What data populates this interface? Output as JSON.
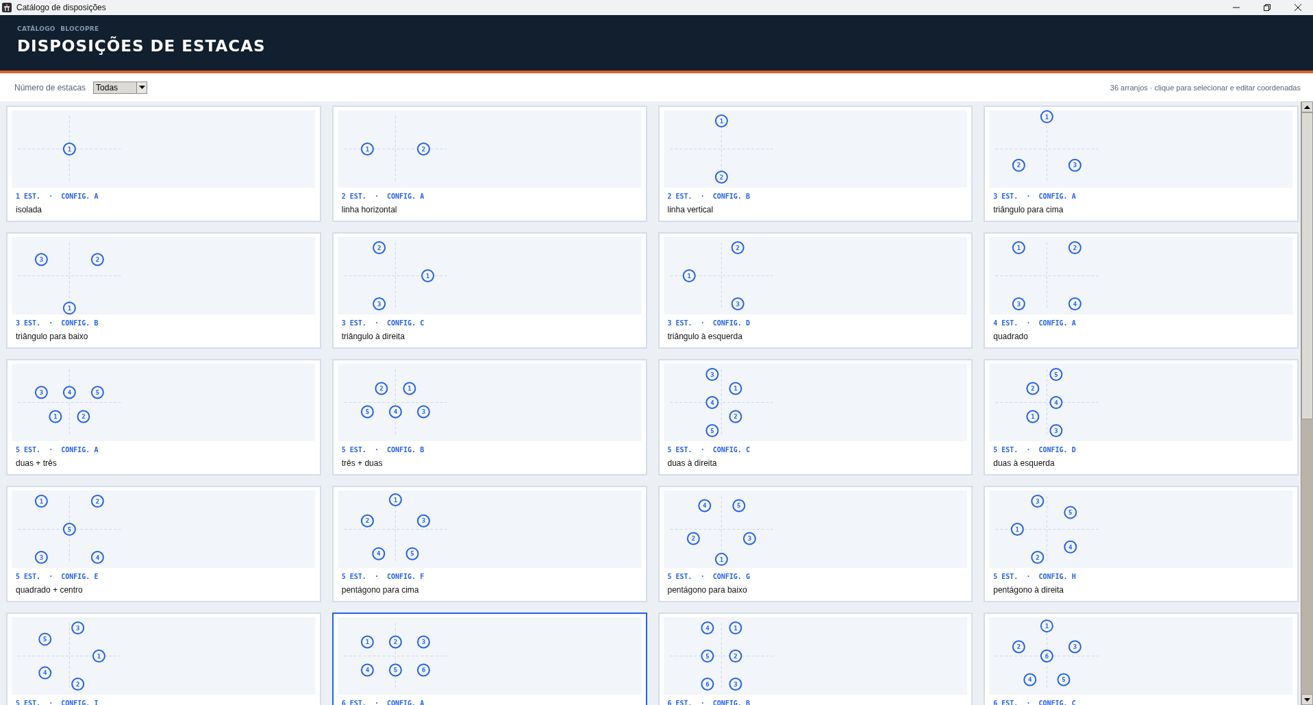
{
  "window": {
    "title": "Catálogo de disposições"
  },
  "header": {
    "eyebrow": "CATÁLOGO BLOCOPRE",
    "title": "DISPOSIÇÕES DE ESTACAS"
  },
  "toolbar": {
    "filter_label": "Número de estacas",
    "filter_value": "Todas",
    "summary": "36 arranjos · clique para selecionar e editar coordenadas"
  },
  "cards": [
    {
      "tag": "1 EST.  ·  CONFIG. A",
      "description": "isolada",
      "selected": false,
      "piles": [
        "1"
      ]
    },
    {
      "tag": "2 EST.  ·  CONFIG. A",
      "description": "linha horizontal",
      "selected": false,
      "piles": [
        "1",
        "2"
      ]
    },
    {
      "tag": "2 EST.  ·  CONFIG. B",
      "description": "linha vertical",
      "selected": false,
      "piles": [
        "1",
        "2"
      ]
    },
    {
      "tag": "3 EST.  ·  CONFIG. A",
      "description": "triângulo para cima",
      "selected": false,
      "piles": [
        "1",
        "2",
        "3"
      ]
    },
    {
      "tag": "3 EST.  ·  CONFIG. B",
      "description": "triângulo para baixo",
      "selected": false,
      "piles": [
        "3",
        "2",
        "1"
      ]
    },
    {
      "tag": "3 EST.  ·  CONFIG. C",
      "description": "triângulo à direita",
      "selected": false,
      "piles": [
        "2",
        "1",
        "3"
      ]
    },
    {
      "tag": "3 EST.  ·  CONFIG. D",
      "description": "triângulo à esquerda",
      "selected": false,
      "piles": [
        "2",
        "1",
        "3"
      ]
    },
    {
      "tag": "4 EST.  ·  CONFIG. A",
      "description": "quadrado",
      "selected": false,
      "piles": [
        "1",
        "2",
        "3",
        "4"
      ]
    },
    {
      "tag": "5 EST.  ·  CONFIG. A",
      "description": "duas + três",
      "selected": false,
      "piles": [
        "3",
        "4",
        "5",
        "1",
        "2"
      ]
    },
    {
      "tag": "5 EST.  ·  CONFIG. B",
      "description": "três + duas",
      "selected": false,
      "piles": [
        "2",
        "1",
        "5",
        "4",
        "3"
      ]
    },
    {
      "tag": "5 EST.  ·  CONFIG. C",
      "description": "duas à direita",
      "selected": false,
      "piles": [
        "3",
        "1",
        "4",
        "2",
        "5"
      ]
    },
    {
      "tag": "5 EST.  ·  CONFIG. D",
      "description": "duas à esquerda",
      "selected": false,
      "piles": [
        "5",
        "2",
        "4",
        "1",
        "3"
      ]
    },
    {
      "tag": "5 EST.  ·  CONFIG. E",
      "description": "quadrado + centro",
      "selected": false,
      "piles": [
        "1",
        "2",
        "5",
        "3",
        "4"
      ]
    },
    {
      "tag": "5 EST.  ·  CONFIG. F",
      "description": "pentágono para cima",
      "selected": false,
      "piles": [
        "1",
        "2",
        "3",
        "4",
        "5"
      ]
    },
    {
      "tag": "5 EST.  ·  CONFIG. G",
      "description": "pentágono para baixo",
      "selected": false,
      "piles": [
        "4",
        "5",
        "2",
        "3",
        "1"
      ]
    },
    {
      "tag": "5 EST.  ·  CONFIG. H",
      "description": "pentágono à direita",
      "selected": false,
      "piles": [
        "3",
        "5",
        "1",
        "4",
        "2"
      ]
    },
    {
      "tag": "5 EST.  ·  CONFIG. I",
      "selected": false,
      "piles": [
        "3",
        "5",
        "1",
        "4",
        "2"
      ]
    },
    {
      "tag": "6 EST.  ·  CONFIG. A",
      "selected": true,
      "piles": [
        "1",
        "2",
        "3",
        "4",
        "5",
        "6"
      ]
    },
    {
      "tag": "6 EST.  ·  CONFIG. B",
      "selected": false,
      "piles": [
        "4",
        "1",
        "5",
        "2",
        "6",
        "3"
      ]
    },
    {
      "tag": "6 EST.  ·  CONFIG. C",
      "selected": false,
      "piles": [
        "1",
        "2",
        "3",
        "6",
        "4",
        "5"
      ]
    }
  ]
}
